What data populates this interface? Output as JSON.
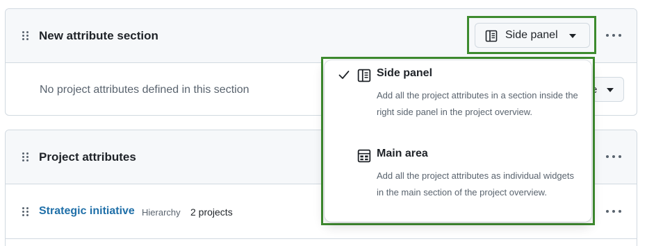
{
  "sections": [
    {
      "title": "New attribute section",
      "display_button": {
        "label": "Side panel",
        "icon": "side-panel-icon"
      },
      "empty_text": "No project attributes defined in this section",
      "hidden_button_fragment": "e"
    },
    {
      "title": "Project attributes",
      "attributes": [
        {
          "name": "Strategic initiative",
          "type": "Hierarchy",
          "count": "2 projects"
        }
      ]
    }
  ],
  "display_menu": {
    "options": [
      {
        "title": "Side panel",
        "description": "Add all the project attributes in a section inside the right side panel in the project overview.",
        "selected": true,
        "icon": "side-panel-icon"
      },
      {
        "title": "Main area",
        "description": "Add all the project attributes as individual widgets in the main section of the project overview.",
        "selected": false,
        "icon": "main-area-icon"
      }
    ]
  },
  "colors": {
    "highlight": "#3d8b2e",
    "link": "#1f6fa8",
    "muted": "#59636e",
    "border": "#d1d9e0"
  }
}
